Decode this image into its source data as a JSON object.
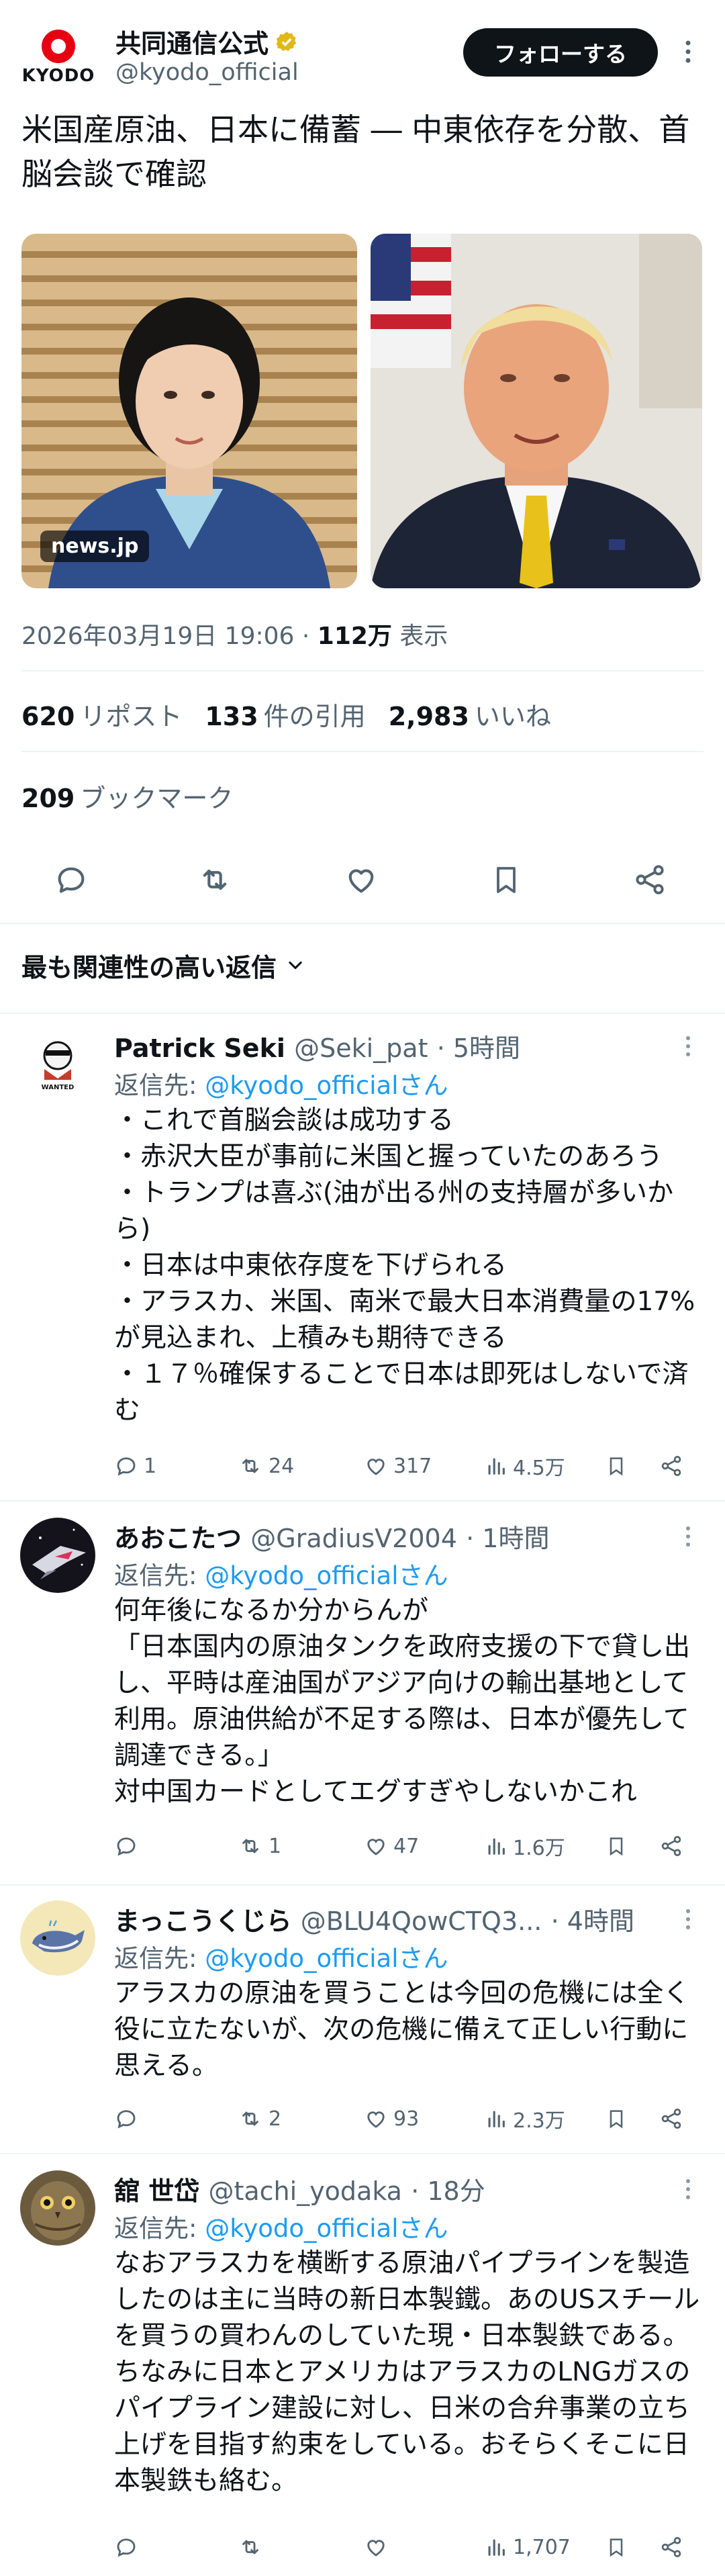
{
  "header": {
    "logo_text": "KYODO",
    "account_name": "共同通信公式",
    "handle": "@kyodo_official",
    "follow_label": "フォローする"
  },
  "post": {
    "text": "米国産原油、日本に備蓄 ― 中東依存を分散、首脳会談で確認",
    "image_source": "news.jp",
    "timestamp": "2026年03月19日 19:06",
    "views_count": "112万",
    "views_label": "表示",
    "reposts_count": "620",
    "reposts_label": "リポスト",
    "quotes_count": "133",
    "quotes_label": "件の引用",
    "likes_count": "2,983",
    "likes_label": "いいね",
    "bookmarks_count": "209",
    "bookmarks_label": "ブックマーク"
  },
  "sort_label": "最も関連性の高い返信",
  "colors": {
    "accent": "#1d9bf0",
    "text": "#0f1419",
    "muted": "#536471",
    "verified": "#e2b719"
  },
  "replies": [
    {
      "name": "Patrick Seki",
      "handle": "@Seki_pat",
      "time": "· 5時間",
      "reply_to_label": "返信先:",
      "reply_to": "@kyodo_officialさん",
      "lines": [
        "・これで首脳会談は成功する",
        "・赤沢大臣が事前に米国と握っていたのあろう",
        "・トランプは喜ぶ(油が出る州の支持層が多いから)",
        "・日本は中東依存度を下げられる",
        "・アラスカ、米国、南米で最大日本消費量の17%が見込まれ、上積みも期待できる",
        "・１７％確保することで日本は即死はしないで済む"
      ],
      "replies": "1",
      "reposts": "24",
      "likes": "317",
      "views": "4.5万",
      "avatar_text": "WANTED"
    },
    {
      "name": "あおこたつ",
      "handle": "@GradiusV2004",
      "time": "· 1時間",
      "reply_to_label": "返信先:",
      "reply_to": "@kyodo_officialさん",
      "lines": [
        "何年後になるか分からんが",
        "「日本国内の原油タンクを政府支援の下で貸し出し、平時は産油国がアジア向けの輸出基地として利用。原油供給が不足する際は、日本が優先して調達できる。」",
        "対中国カードとしてエグすぎやしないかこれ"
      ],
      "replies": "",
      "reposts": "1",
      "likes": "47",
      "views": "1.6万"
    },
    {
      "name": "まっこうくじら",
      "handle": "@BLU4QowCTQ3...",
      "time": "· 4時間",
      "reply_to_label": "返信先:",
      "reply_to": "@kyodo_officialさん",
      "lines": [
        "アラスカの原油を買うことは今回の危機には全く役に立たないが、次の危機に備えて正しい行動に思える。"
      ],
      "replies": "",
      "reposts": "2",
      "likes": "93",
      "views": "2.3万"
    },
    {
      "name": "舘 世岱",
      "handle": "@tachi_yodaka",
      "time": "· 18分",
      "reply_to_label": "返信先:",
      "reply_to": "@kyodo_officialさん",
      "lines": [
        "なおアラスカを横断する原油パイプラインを製造したのは主に当時の新日本製鐵。あのUSスチールを買うの買わんのしていた現・日本製鉄である。ちなみに日本とアメリカはアラスカのLNGガスのパイプライン建設に対し、日米の合弁事業の立ち上げを目指す約束をしている。おそらくそこに日本製鉄も絡む。"
      ],
      "replies": "",
      "reposts": "",
      "likes": "",
      "views": "1,707"
    }
  ]
}
